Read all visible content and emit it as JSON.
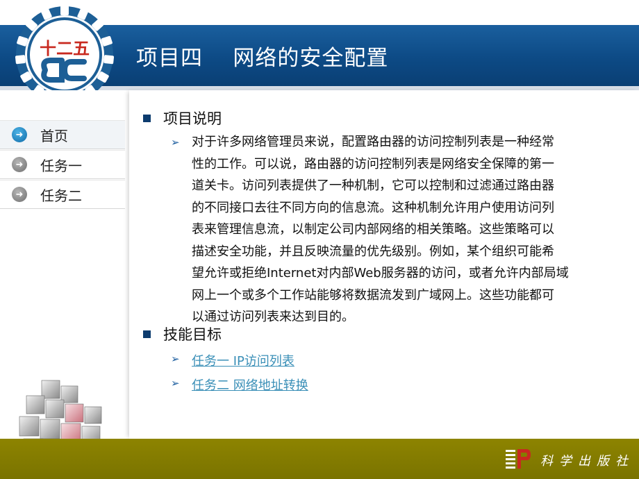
{
  "header": {
    "title": "项目四    网络的安全配置",
    "logo_text": "十二五"
  },
  "sidebar": {
    "items": [
      {
        "label": "首页",
        "icon": "arrow-right-icon",
        "active": true
      },
      {
        "label": "任务一",
        "icon": "arrow-right-icon",
        "active": false
      },
      {
        "label": "任务二",
        "icon": "arrow-right-icon",
        "active": false
      }
    ]
  },
  "content": {
    "section1_heading": "项目说明",
    "description_lines": [
      "对于许多网络管理员来说，配置路由器的访问控制列表是一种经常",
      "性的工作。可以说，路由器的访问控制列表是网络安全保障的第一",
      "道关卡。访问列表提供了一种机制，它可以控制和过滤通过路由器",
      "的不同接口去往不同方向的信息流。这种机制允许用户使用访问列",
      "表来管理信息流，以制定公司内部网络的相关策略。这些策略可以",
      "描述安全功能，并且反映流量的优先级别。例如，某个组织可能希",
      "望允许或拒绝Internet对内部Web服务器的访问，或者允许内部局域",
      "网上一个或多个工作站能够将数据流发到广域网上。这些功能都可",
      "以通过访问列表来达到目的。"
    ],
    "section2_heading": "技能目标",
    "links": [
      {
        "label": "任务一  IP访问列表"
      },
      {
        "label": "任务二  网络地址转换"
      }
    ]
  },
  "footer": {
    "publisher": "科学出版社"
  },
  "colors": {
    "header_blue": "#0d4a85",
    "footer_olive": "#857d00",
    "link": "#3a8fb7",
    "bullet_navy": "#0d3c6e"
  }
}
